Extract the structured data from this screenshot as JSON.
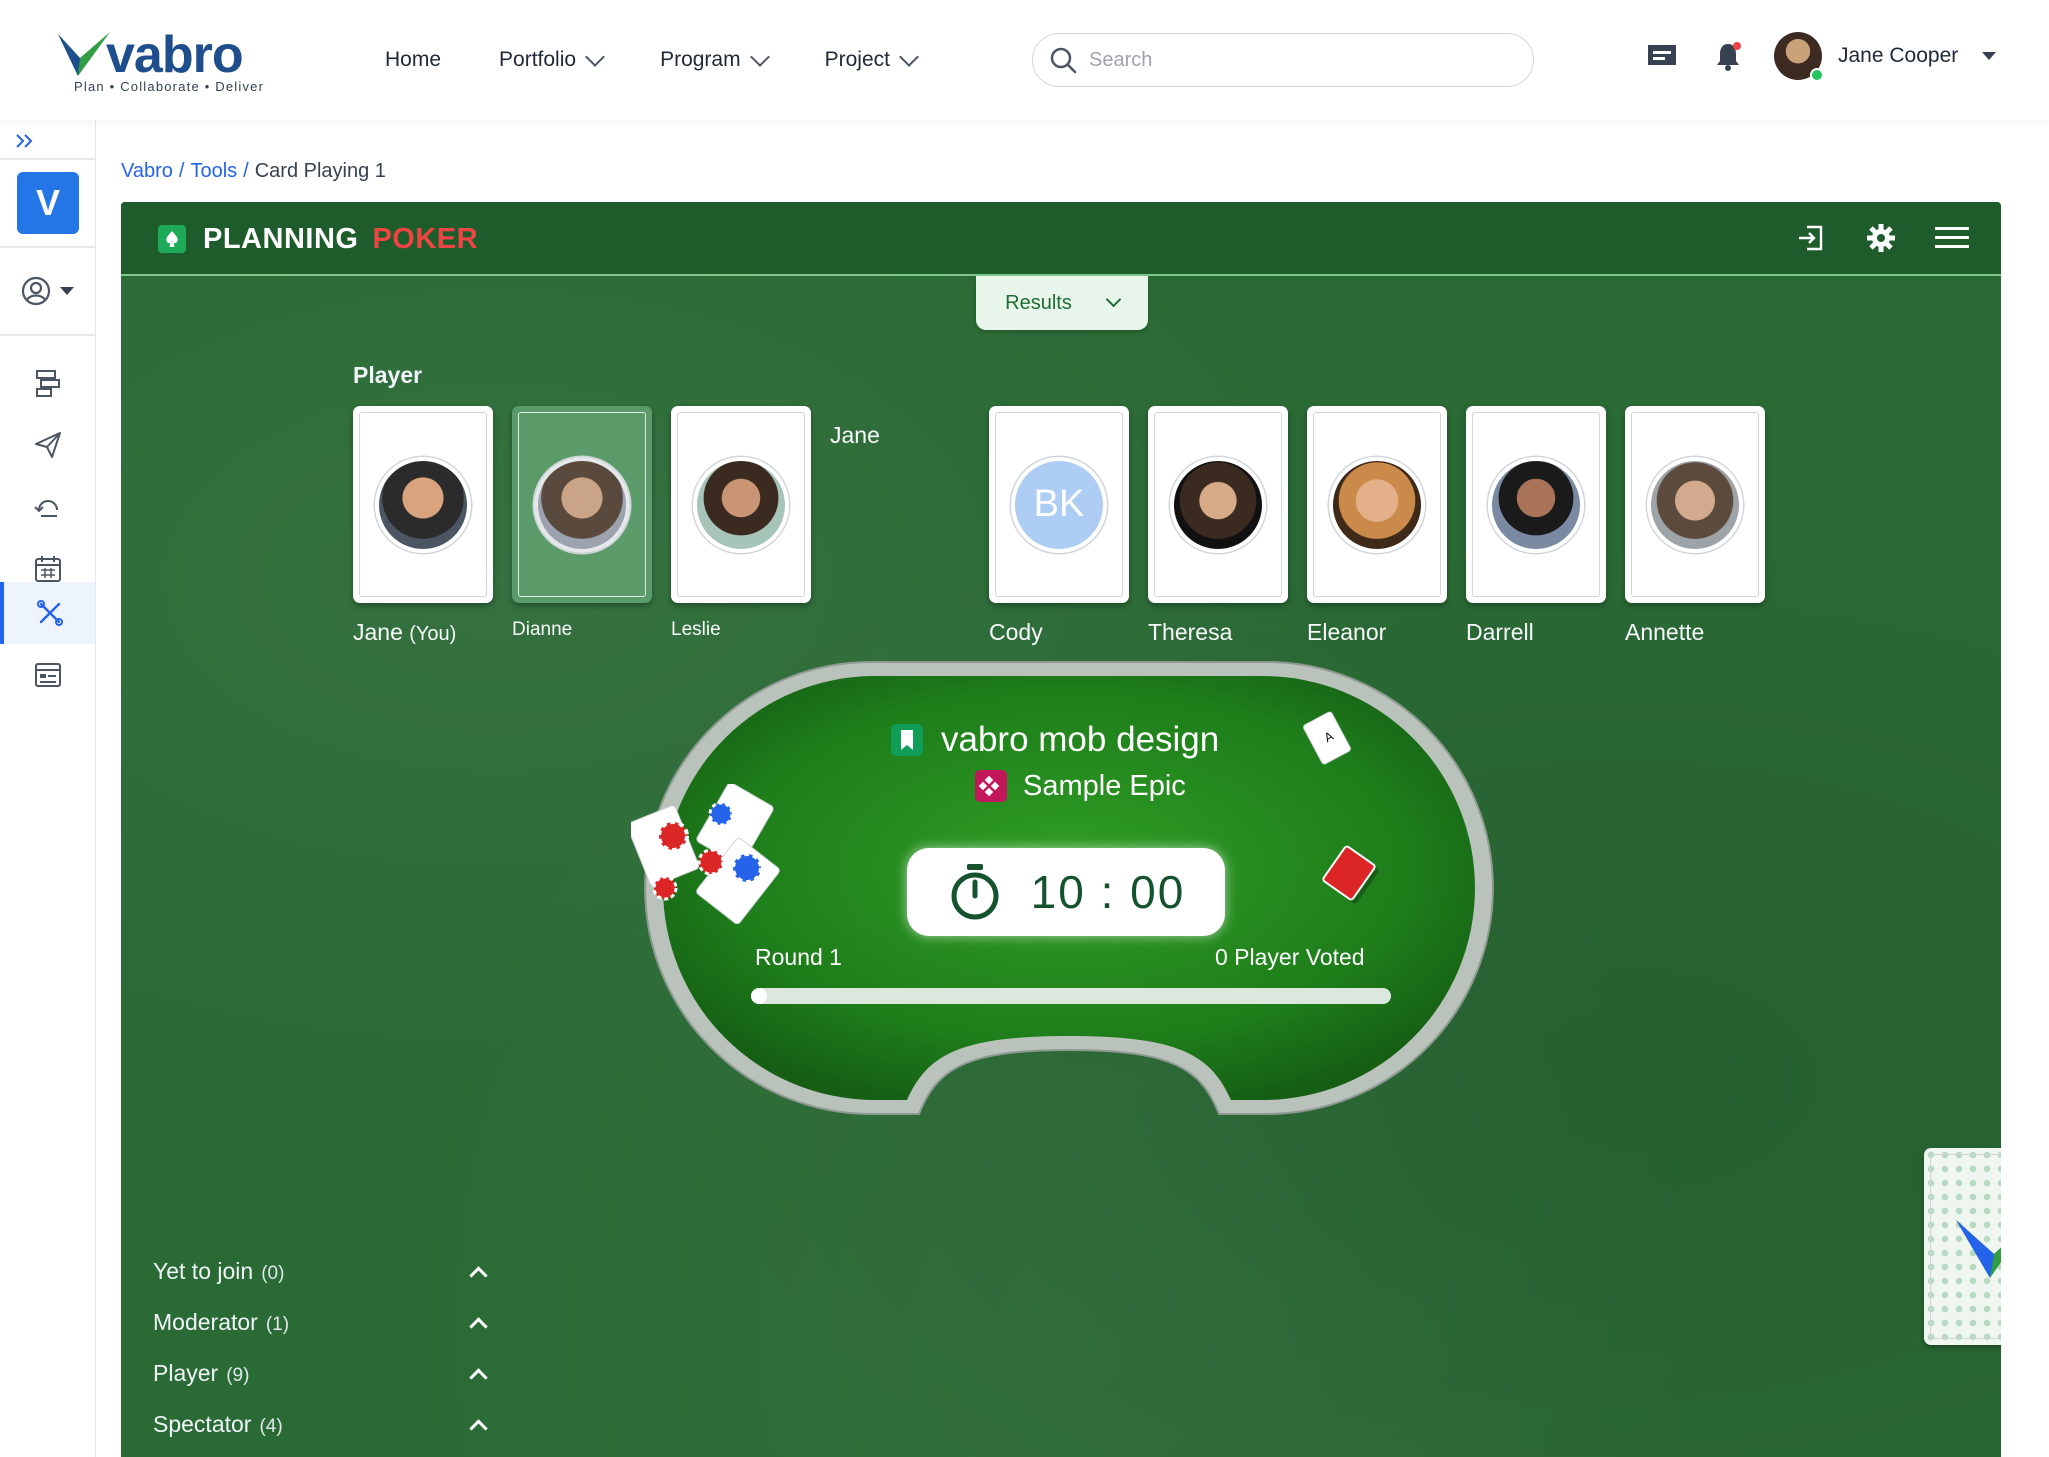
{
  "app": {
    "logo_text": "vabro",
    "logo_tagline": "Plan • Collaborate • Deliver"
  },
  "nav": {
    "items": [
      {
        "label": "Home",
        "dropdown": false
      },
      {
        "label": "Portfolio",
        "dropdown": true
      },
      {
        "label": "Program",
        "dropdown": true
      },
      {
        "label": "Project",
        "dropdown": true
      }
    ]
  },
  "search": {
    "placeholder": "Search",
    "value": ""
  },
  "user": {
    "name": "Jane Cooper",
    "status": "online"
  },
  "sidebar": {
    "workspace_initial": "V"
  },
  "breadcrumb": {
    "items": [
      "Vabro",
      "Tools"
    ],
    "current": "Card Playing 1"
  },
  "game": {
    "title_part1": "PLANNING",
    "title_part2": "POKER",
    "results_label": "Results",
    "players_heading": "Player",
    "players": [
      {
        "name": "Jane",
        "suffix": "(You)",
        "state": "avatar"
      },
      {
        "name": "Dianne",
        "suffix": "",
        "state": "selected"
      },
      {
        "name": "Leslie",
        "suffix": "",
        "state": "avatar"
      },
      {
        "name": "Jane",
        "suffix": "",
        "state": "voted"
      },
      {
        "name": "Cody",
        "suffix": "",
        "state": "initials",
        "initials": "BK"
      },
      {
        "name": "Theresa",
        "suffix": "",
        "state": "avatar"
      },
      {
        "name": "Eleanor",
        "suffix": "",
        "state": "avatar"
      },
      {
        "name": "Darrell",
        "suffix": "",
        "state": "avatar"
      },
      {
        "name": "Annette",
        "suffix": "",
        "state": "avatar"
      }
    ],
    "story_title": "vabro mob design",
    "epic_name": "Sample Epic",
    "timer": "10 : 00",
    "round_label": "Round 1",
    "voted_label": "0 Player Voted",
    "vote_progress": 0.0,
    "groups": [
      {
        "label": "Yet to join",
        "count": "(0)"
      },
      {
        "label": "Moderator",
        "count": "(1)"
      },
      {
        "label": "Player",
        "count": "(9)"
      },
      {
        "label": "Spectator",
        "count": "(4)"
      }
    ]
  },
  "colors": {
    "brand_blue": "#1e4e8c",
    "accent_blue": "#2563eb",
    "board_green": "#2a6a35",
    "table_green": "#1f7a1f",
    "poker_red": "#ef4444"
  }
}
